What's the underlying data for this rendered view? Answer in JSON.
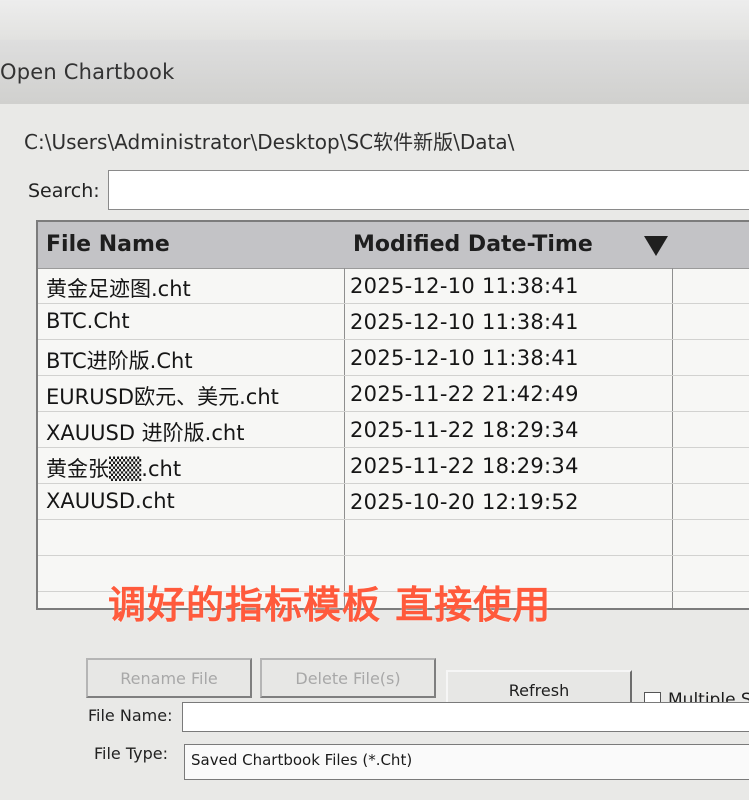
{
  "window": {
    "title": "Open Chartbook"
  },
  "path": "C:\\Users\\Administrator\\Desktop\\SC软件新版\\Data\\",
  "search": {
    "label": "Search:",
    "value": ""
  },
  "columns": {
    "name": "File Name",
    "date": "Modified Date-Time",
    "sort_icon": "sort-desc-triangle-icon"
  },
  "files": [
    {
      "name": "黄金足迹图.cht",
      "date": "2025-12-10  11:38:41"
    },
    {
      "name": "BTC.Cht",
      "date": "2025-12-10  11:38:41"
    },
    {
      "name": "BTC进阶版.Cht",
      "date": "2025-12-10  11:38:41"
    },
    {
      "name": "EURUSD欧元、美元.cht",
      "date": "2025-11-22  21:42:49"
    },
    {
      "name": "XAUUSD 进阶版.cht",
      "date": "2025-11-22  18:29:34"
    },
    {
      "name": "黄金张▒▒.cht",
      "date": "2025-11-22  18:29:34"
    },
    {
      "name": "XAUUSD.cht",
      "date": "2025-10-20  12:19:52"
    }
  ],
  "overlay": "调好的指标模板 直接使用",
  "buttons": {
    "rename": "Rename File",
    "delete": "Delete File(s)",
    "refresh": "Refresh"
  },
  "multiple": {
    "label": "Multiple S",
    "checked": false
  },
  "file_name": {
    "label": "File Name:",
    "value": ""
  },
  "file_type": {
    "label": "File Type:",
    "value": "Saved Chartbook Files (*.Cht)"
  },
  "colors": {
    "overlay": "#ff5a3c",
    "header_bg": "#c3c3c6"
  }
}
